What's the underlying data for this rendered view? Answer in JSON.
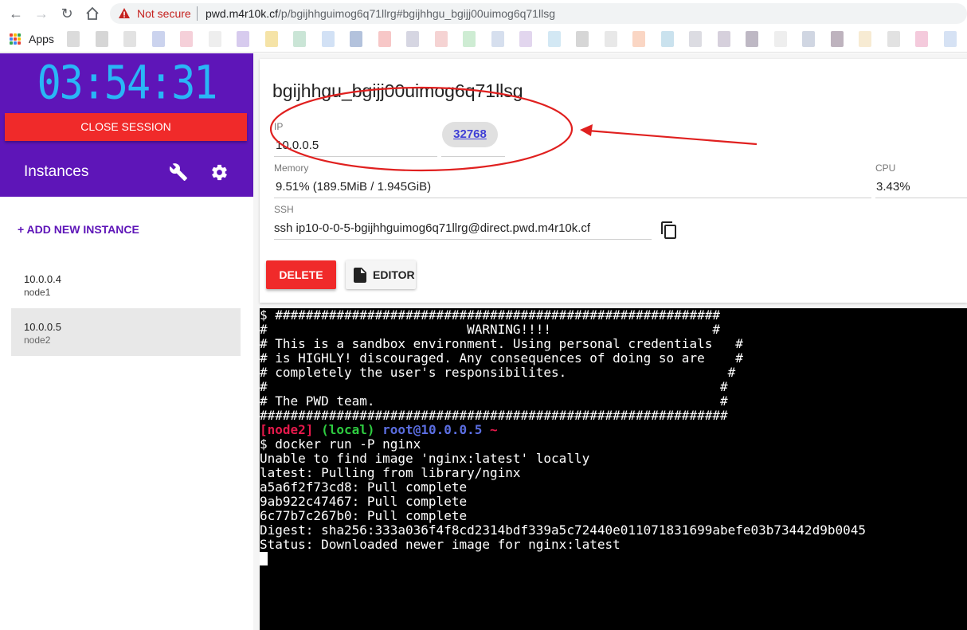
{
  "browser": {
    "not_secure": "Not secure",
    "url_host": "pwd.m4r10k.cf",
    "url_path": "/p/bgijhhguimog6q71llrg#bgijhhgu_bgijj00uimog6q71llsg",
    "apps_label": "Apps",
    "bookmark_colors": [
      "#cfcfcf",
      "#c8c8c8",
      "#d8d8d8",
      "#b9c4e8",
      "#f2c0cc",
      "#e8e8e8",
      "#c9b9e8",
      "#f2d98a",
      "#b8dcc8",
      "#c3d7f2",
      "#9aaed0",
      "#f4b4b4",
      "#c8c8d8",
      "#f2c4c4",
      "#bde6c4",
      "#c8d4e8",
      "#d8c8e8",
      "#c4e0f0",
      "#c8c8c8",
      "#e0e0e0",
      "#f8c8b0",
      "#b8d8e8",
      "#d0d0d8",
      "#c8c0d0",
      "#a8a0b0",
      "#e8e8e8",
      "#c0c8d8",
      "#a89aa8",
      "#f4e4c4",
      "#d8d8d8",
      "#f0b8d0",
      "#c8d8f0"
    ]
  },
  "sidebar": {
    "timer": "03:54:31",
    "close_label": "CLOSE SESSION",
    "instances_title": "Instances",
    "add_instance_label": "+ ADD NEW INSTANCE",
    "instances": [
      {
        "ip": "10.0.0.4",
        "name": "node1",
        "selected": false
      },
      {
        "ip": "10.0.0.5",
        "name": "node2",
        "selected": true
      }
    ]
  },
  "instance": {
    "title": "bgijhhgu_bgijj00uimog6q71llsg",
    "ip_label": "IP",
    "ip_value": "10.0.0.5",
    "port": "32768",
    "memory_label": "Memory",
    "memory_value": "9.51% (189.5MiB / 1.945GiB)",
    "cpu_label": "CPU",
    "cpu_value": "3.43%",
    "ssh_label": "SSH",
    "ssh_value": "ssh ip10-0-0-5-bgijhhguimog6q71llrg@direct.pwd.m4r10k.cf",
    "delete_label": "DELETE",
    "editor_label": "EDITOR"
  },
  "terminal": {
    "banner": [
      "$ ##########################################################",
      "#                          WARNING!!!!                     #",
      "# This is a sandbox environment. Using personal credentials   #",
      "# is HIGHLY! discouraged. Any consequences of doing so are    #",
      "# completely the user's responsibilites.                     #",
      "#                                                           #",
      "# The PWD team.                                             #",
      "#############################################################"
    ],
    "prompt_node": "[node2]",
    "prompt_local": "(local)",
    "prompt_root": "root@10.0.0.5",
    "prompt_tilde": "~",
    "output": [
      "$ docker run -P nginx",
      "Unable to find image 'nginx:latest' locally",
      "latest: Pulling from library/nginx",
      "a5a6f2f73cd8: Pull complete",
      "9ab922c47467: Pull complete",
      "6c77b7c267b0: Pull complete",
      "Digest: sha256:333a036f4f8cd2314bdf339a5c72440e011071831699abefe03b73442d9b0045",
      "Status: Downloaded newer image for nginx:latest"
    ]
  },
  "colors": {
    "brand_purple": "#5e15b8",
    "danger_red": "#f02a2a",
    "timer_blue": "#29b6f6",
    "annotation_red": "#e0201f"
  }
}
